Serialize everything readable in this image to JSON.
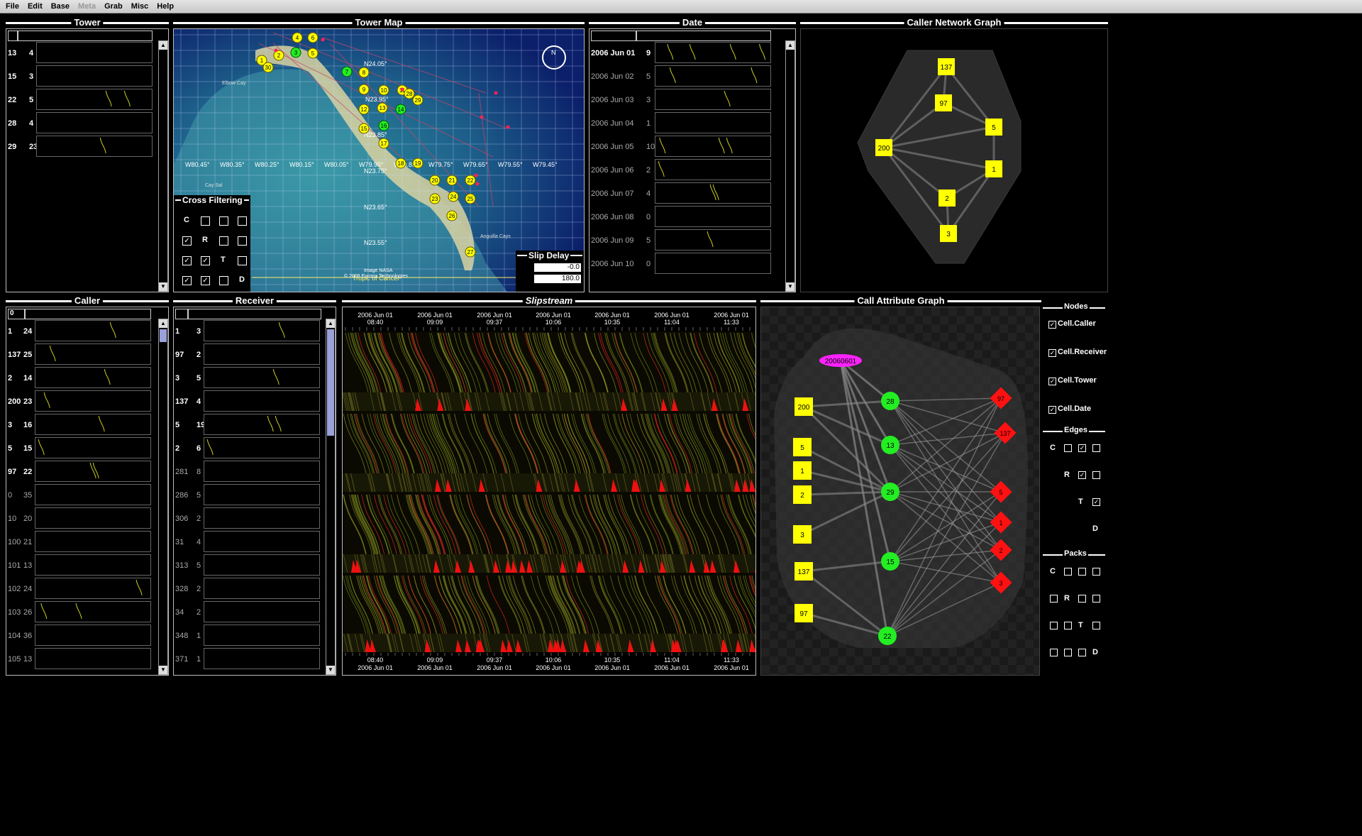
{
  "menu": [
    "File",
    "Edit",
    "Base",
    "Meta",
    "Grab",
    "Misc",
    "Help"
  ],
  "panels": {
    "tower": "Tower",
    "map": "Tower Map",
    "date": "Date",
    "caller_net": "Caller Network Graph",
    "caller": "Caller",
    "receiver": "Receiver",
    "slipstream": "Slipstream",
    "call_attr": "Call Attribute Graph"
  },
  "tower_rows": [
    [
      "13",
      "4"
    ],
    [
      "15",
      "3"
    ],
    [
      "22",
      "5"
    ],
    [
      "28",
      "4"
    ],
    [
      "29",
      "23"
    ]
  ],
  "date_header": "",
  "date_rows": [
    [
      "2006 Jun 01",
      "9"
    ],
    [
      "2006 Jun 02",
      "5"
    ],
    [
      "2006 Jun 03",
      "3"
    ],
    [
      "2006 Jun 04",
      "1"
    ],
    [
      "2006 Jun 05",
      "10"
    ],
    [
      "2006 Jun 06",
      "2"
    ],
    [
      "2006 Jun 07",
      "4"
    ],
    [
      "2006 Jun 08",
      "0"
    ],
    [
      "2006 Jun 09",
      "5"
    ],
    [
      "2006 Jun 10",
      "0"
    ]
  ],
  "caller_header": "0",
  "caller_rows": [
    [
      "1",
      "24"
    ],
    [
      "137",
      "25"
    ],
    [
      "2",
      "14"
    ],
    [
      "200",
      "23"
    ],
    [
      "3",
      "16"
    ],
    [
      "5",
      "15"
    ],
    [
      "97",
      "22"
    ],
    [
      "0",
      "35"
    ],
    [
      "10",
      "20"
    ],
    [
      "100",
      "21"
    ],
    [
      "101",
      "13"
    ],
    [
      "102",
      "24"
    ],
    [
      "103",
      "26"
    ],
    [
      "104",
      "36"
    ],
    [
      "105",
      "13"
    ]
  ],
  "receiver_rows": [
    [
      "1",
      "3"
    ],
    [
      "97",
      "2"
    ],
    [
      "3",
      "5"
    ],
    [
      "137",
      "4"
    ],
    [
      "5",
      "19"
    ],
    [
      "2",
      "6"
    ],
    [
      "281",
      "8"
    ],
    [
      "286",
      "5"
    ],
    [
      "306",
      "2"
    ],
    [
      "31",
      "4"
    ],
    [
      "313",
      "5"
    ],
    [
      "328",
      "2"
    ],
    [
      "34",
      "2"
    ],
    [
      "348",
      "1"
    ],
    [
      "371",
      "1"
    ]
  ],
  "map": {
    "lon_labels": [
      "W80.45°",
      "W80.35°",
      "W80.25°",
      "W80.15°",
      "W80.05°",
      "W79.95°",
      "W79.85°",
      "W79.75°",
      "W79.65°",
      "W79.55°",
      "W79.45°"
    ],
    "lat_labels": [
      "N24.05°",
      "N23.95°",
      "N23.85°",
      "N23.75°",
      "N23.65°",
      "N23.55°"
    ],
    "places": [
      "Elbow Cay",
      "Cay Sal",
      "Anguilla Cays",
      "Tropic of Cancer"
    ],
    "credit1": "Image NASA",
    "credit2": "© 2008 Europa Technologies",
    "towers_yellow": [
      "1",
      "2",
      "4",
      "5",
      "30",
      "8",
      "9",
      "10",
      "11",
      "28",
      "29",
      "12",
      "13",
      "15",
      "17",
      "18",
      "19",
      "20",
      "21",
      "22",
      "23",
      "24",
      "25",
      "26",
      "27",
      "6"
    ],
    "towers_green": [
      "3",
      "7",
      "14",
      "16"
    ]
  },
  "cross_filter": {
    "title": "Cross Filtering",
    "row_labels": [
      "C",
      "R",
      "T",
      "D"
    ]
  },
  "slip_delay": {
    "title": "Slip Delay",
    "v1": "-0.0",
    "v2": "180.0"
  },
  "slip_times": [
    [
      "2006 Jun 01",
      "08:40"
    ],
    [
      "2006 Jun 01",
      "09:09"
    ],
    [
      "2006 Jun 01",
      "09:37"
    ],
    [
      "2006 Jun 01",
      "10:06"
    ],
    [
      "2006 Jun 01",
      "10:35"
    ],
    [
      "2006 Jun 01",
      "11:04"
    ],
    [
      "2006 Jun 01",
      "11:33"
    ]
  ],
  "caller_graph_nodes": [
    "137",
    "97",
    "5",
    "200",
    "1",
    "2",
    "3"
  ],
  "attr_graph": {
    "date_node": "20060601",
    "callers": [
      "200",
      "5",
      "1",
      "2",
      "3",
      "137",
      "97"
    ],
    "towers": [
      "28",
      "13",
      "29",
      "15",
      "22"
    ],
    "receivers": [
      "97",
      "137",
      "5",
      "1",
      "2",
      "3"
    ]
  },
  "nodes_panel": {
    "title": "Nodes",
    "items": [
      "Cell.Caller",
      "Cell.Receiver",
      "Cell.Tower",
      "Cell.Date"
    ],
    "edges": "Edges",
    "packs": "Packs",
    "letters": [
      "C",
      "R",
      "T",
      "D"
    ]
  },
  "colors": {
    "yellow": "#ffff00",
    "green": "#22ee22",
    "red": "#ff1111",
    "magenta": "#ff22ff"
  }
}
